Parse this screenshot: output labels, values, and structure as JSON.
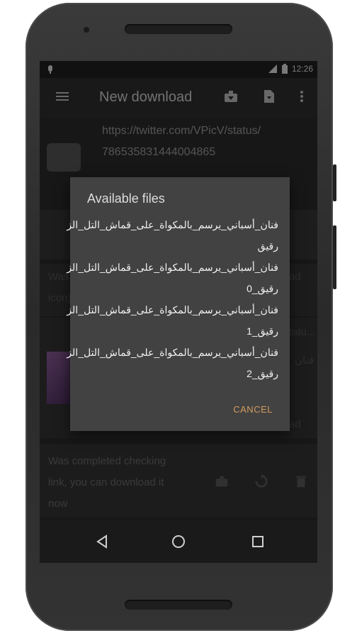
{
  "status_bar": {
    "time": "12:26"
  },
  "toolbar": {
    "title": "New download"
  },
  "url": {
    "line1": "https://twitter.com/VPicV/status/",
    "line2": "786535831444004865"
  },
  "dialog": {
    "title": "Available files",
    "files": [
      {
        "line1": "فنان_أسباني_يرسم_بالمكواة_على_قماش_التل_الز",
        "line2": "رقيق"
      },
      {
        "line1": "فنان_أسباني_يرسم_بالمكواة_على_قماش_التل_الز",
        "line2": "رقيق_0"
      },
      {
        "line1": "فنان_أسباني_يرسم_بالمكواة_على_قماش_التل_الز",
        "line2": "رقيق_1"
      },
      {
        "line1": "فنان_أسباني_يرسم_بالمكواة_على_قماش_التل_الز",
        "line2": "رقيق_2"
      }
    ],
    "cancel_label": "CANCEL"
  },
  "background_rows": {
    "row1": "Was",
    "row1_tail": "ad",
    "row1b": "icon)",
    "row2_tail": "tatu...",
    "row2b_tail": "فنان",
    "row3_tail": "ad",
    "status_card": {
      "line1": "Was completed checking",
      "line2": "link, you can download it",
      "line3": "now"
    }
  },
  "colors": {
    "accent": "#d39b60",
    "dialog_bg": "#424242",
    "screen_bg": "#2b2b2b"
  }
}
